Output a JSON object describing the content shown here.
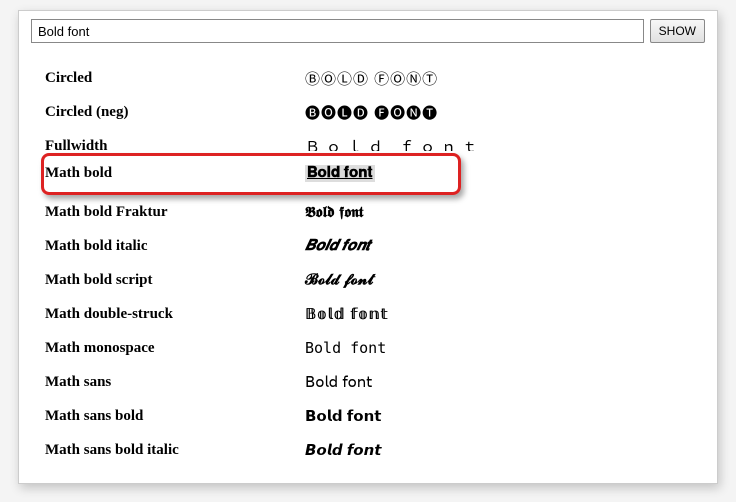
{
  "input": {
    "value": "Bold font"
  },
  "button": {
    "label": "SHOW"
  },
  "rows": [
    {
      "label": "Circled",
      "value": "ⒷⓄⓁⒹ ⒻⓄⓃⓉ"
    },
    {
      "label": "Circled (neg)",
      "value": "🅑🅞🅛🅓 🅕🅞🅝🅣"
    },
    {
      "label": "Fullwidth",
      "value": "Ｂｏｌｄ ｆｏｎｔ"
    },
    {
      "label": "Math bold",
      "value": "𝐁𝐨𝐥𝐝 𝐟𝐨𝐧𝐭"
    },
    {
      "label": "Math bold Fraktur",
      "value": "𝕭𝖔𝖑𝖉 𝖋𝖔𝖓𝖙"
    },
    {
      "label": "Math bold italic",
      "value": "𝑩𝒐𝒍𝒅 𝒇𝒐𝒏𝒕"
    },
    {
      "label": "Math bold script",
      "value": "𝓑𝓸𝓵𝓭 𝓯𝓸𝓷𝓽"
    },
    {
      "label": "Math double-struck",
      "value": "𝔹𝕠𝕝𝕕 𝕗𝕠𝕟𝕥"
    },
    {
      "label": "Math monospace",
      "value": "𝙱𝚘𝚕𝚍 𝚏𝚘𝚗𝚝"
    },
    {
      "label": "Math sans",
      "value": "𝖡𝗈𝗅𝖽 𝖿𝗈𝗇𝗍"
    },
    {
      "label": "Math sans bold",
      "value": "𝗕𝗼𝗹𝗱 𝗳𝗼𝗻𝘁"
    },
    {
      "label": "Math sans bold italic",
      "value": "𝘽𝙤𝙡𝙙 𝙛𝙤𝙣𝙩"
    }
  ]
}
